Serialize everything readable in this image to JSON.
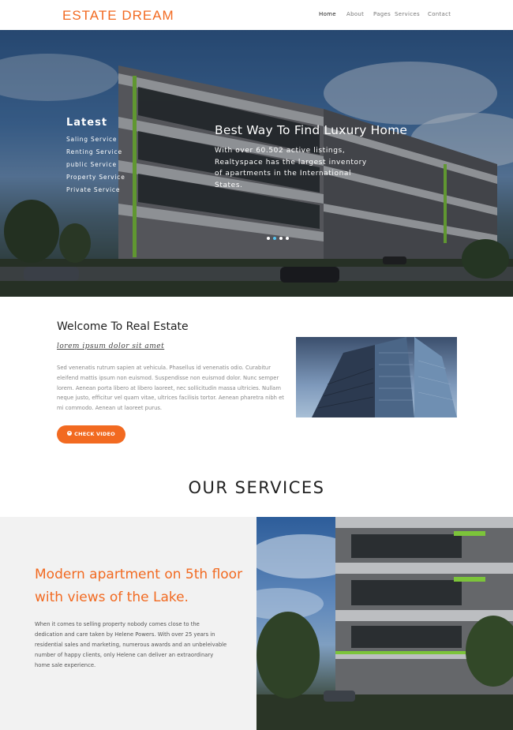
{
  "nav": {
    "brand": "ESTATE DREAM",
    "items": [
      "Home",
      "About",
      "Pages",
      "Services",
      "Contact"
    ]
  },
  "hero": {
    "latest_title": "Latest",
    "latest_items": [
      "Saling Service",
      "Renting Service",
      "public Service",
      "Property Service",
      "Private Service"
    ],
    "headline": "Best Way To Find Luxury Home",
    "copy": "With over 60.502 active listings, Realtyspace has the largest inventory of apartments in the International States.",
    "slides": 4,
    "active_slide": 2
  },
  "welcome": {
    "title": "Welcome To Real Estate",
    "subtitle": "lorem ipsum dolor sit amet",
    "body": "Sed venenatis rutrum sapien at vehicula. Phasellus id venenatis odio. Curabitur eleifend mattis ipsum non euismod. Suspendisse non euismod dolor. Nunc semper lorem. Aenean porta libero at libero laoreet, nec sollicitudin massa ultricies. Nullam neque justo, efficitur vel quam vitae, ultrices facilisis tortor. Aenean pharetra nibh et mi commodo. Aenean ut laoreet purus.",
    "cta_label": "CHECK VIDEO",
    "cta_icon": "play-circle-icon"
  },
  "services": {
    "title": "OUR SERVICES",
    "heading": "Modern apartment on 5th floor with views of the Lake.",
    "body": "When it comes to selling property nobody comes close to the dedication and care taken by Helene Powers. With over 25 years in residential sales and marketing, numerous awards and an unbeleivable number of happy clients, only Helene can deliver an extraordinary home sale experience."
  },
  "colors": {
    "accent": "#f26a21",
    "text": "#222222",
    "muted": "#888888",
    "panel": "#f2f2f2"
  }
}
